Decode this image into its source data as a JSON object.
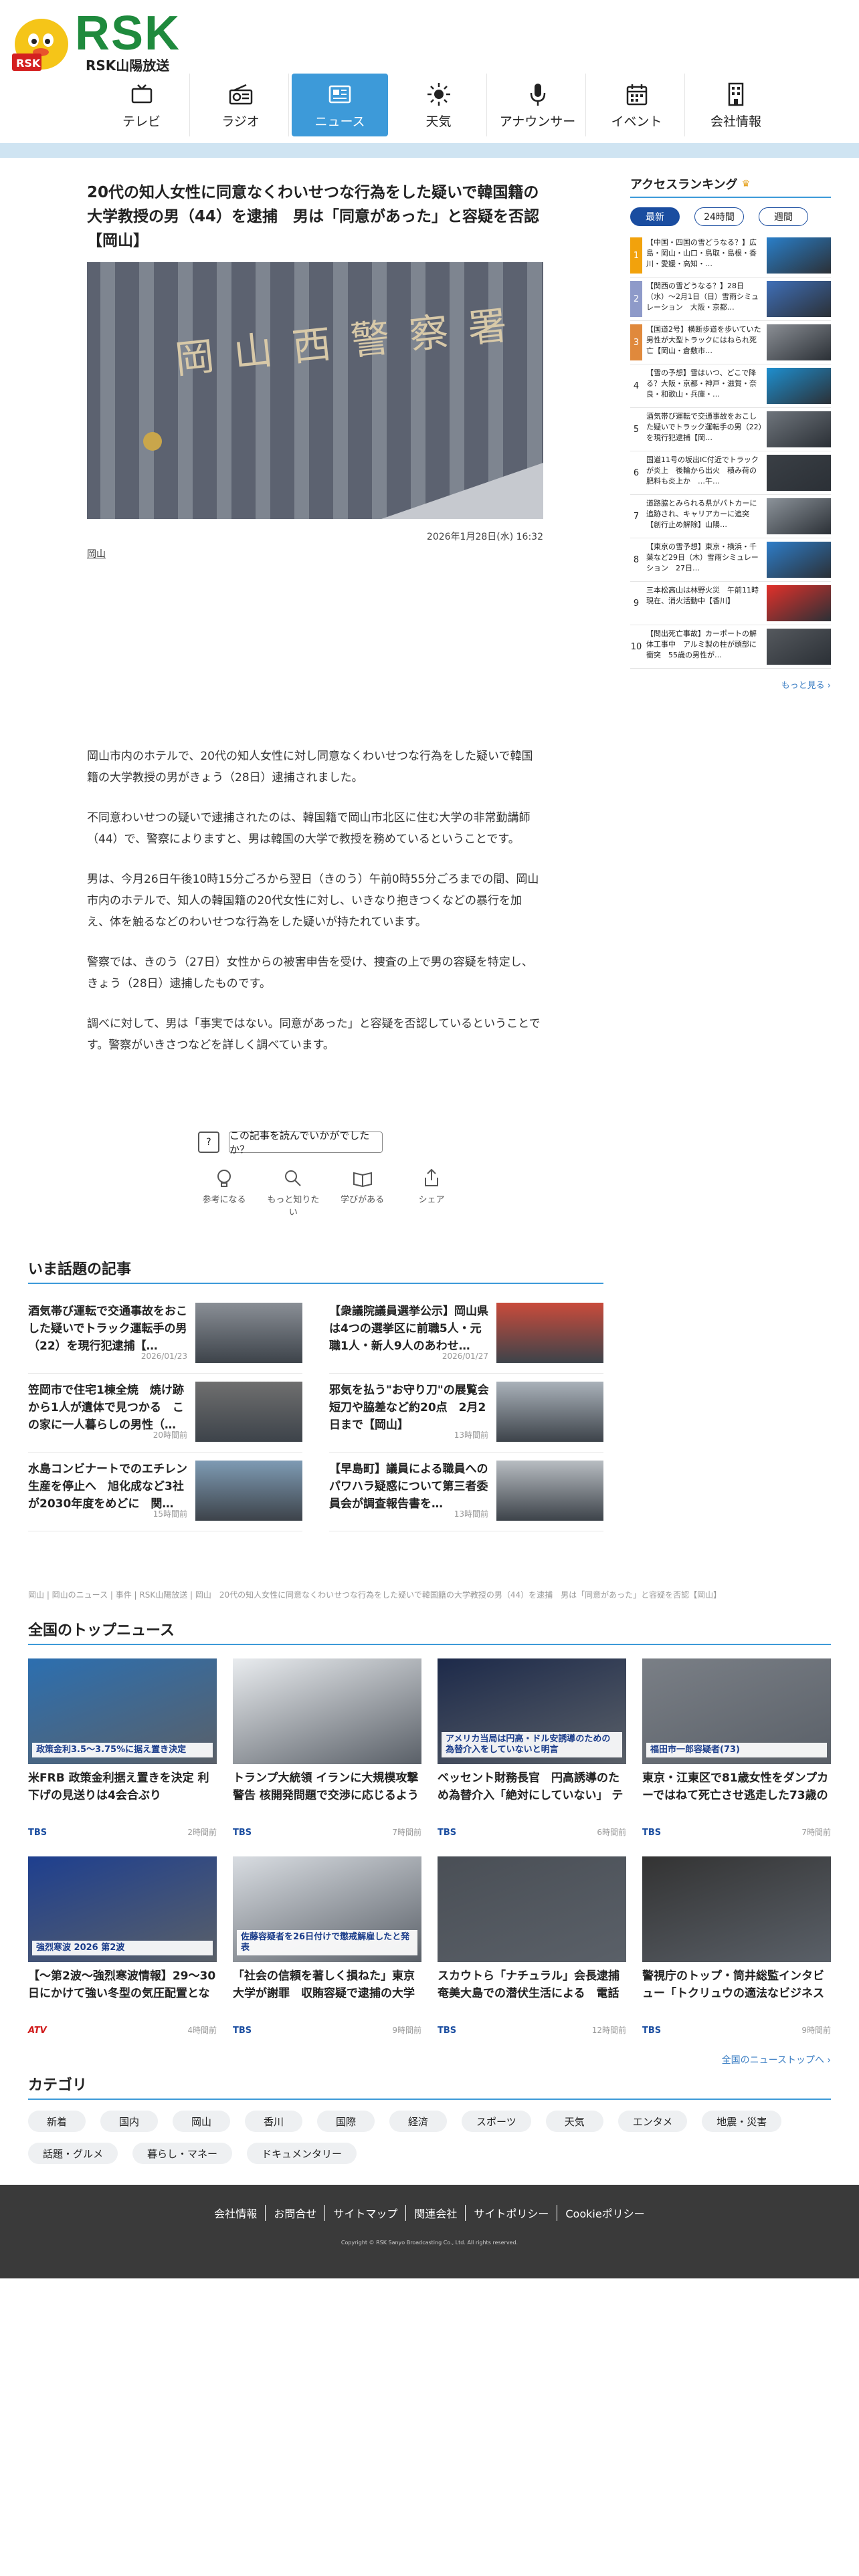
{
  "brand": {
    "logo": "RSK",
    "sub": "RSK山陽放送"
  },
  "nav": [
    {
      "label": "テレビ",
      "icon": "tv-icon"
    },
    {
      "label": "ラジオ",
      "icon": "radio-icon"
    },
    {
      "label": "ニュース",
      "icon": "news-icon",
      "active": true
    },
    {
      "label": "天気",
      "icon": "sun-icon"
    },
    {
      "label": "アナウンサー",
      "icon": "microphone-icon"
    },
    {
      "label": "イベント",
      "icon": "calendar-icon"
    },
    {
      "label": "会社情報",
      "icon": "building-icon"
    }
  ],
  "article": {
    "title": "20代の知人女性に同意なくわいせつな行為をした疑いで韓国籍の大学教授の男（44）を逮捕　男は「同意があった」と容疑を否認【岡山】",
    "photo_sign": "岡山西警察署",
    "date": "2026年1月28日(水) 16:32",
    "tag": "岡山",
    "body": [
      "岡山市内のホテルで、20代の知人女性に対し同意なくわいせつな行為をした疑いで韓国籍の大学教授の男がきょう（28日）逮捕されました。",
      "不同意わいせつの疑いで逮捕されたのは、韓国籍で岡山市北区に住む大学の非常勤講師（44）で、警察によりますと、男は韓国の大学で教授を務めているということです。",
      "男は、今月26日午後10時15分ごろから翌日（きのう）午前0時55分ごろまでの間、岡山市内のホテルで、知人の韓国籍の20代女性に対し、いきなり抱きつくなどの暴行を加え、体を触るなどのわいせつな行為をした疑いが持たれています。",
      "警察では、きのう（27日）女性からの被害申告を受け、捜査の上で男の容疑を特定し、きょう（28日）逮捕したものです。",
      "調べに対して、男は「事実ではない。同意があった」と容疑を否認しているということです。警察がいきさつなどを詳しく調べています。"
    ]
  },
  "feedback": {
    "icon_label": "?",
    "button": "この記事を読んでいかがでしたか？"
  },
  "reactions": [
    {
      "label": "参考になる",
      "icon": "lightbulb-icon"
    },
    {
      "label": "もっと知りたい",
      "icon": "magnifier-icon"
    },
    {
      "label": "学びがある",
      "icon": "book-icon"
    },
    {
      "label": "シェア",
      "icon": "share-icon"
    }
  ],
  "topics": {
    "title": "いま話題の記事",
    "items": [
      {
        "text": "酒気帯び運転で交通事故をおこした疑いでトラック運転手の男（22）を現行犯逮捕【…",
        "date": "2026/01/23"
      },
      {
        "text": "【衆議院議員選挙公示】岡山県は4つの選挙区に前職5人・元職1人・新人9人のあわせ…",
        "date": "2026/01/27"
      },
      {
        "text": "笠岡市で住宅1棟全焼　焼け跡から1人が遺体で見つかる　この家に一人暮らしの男性（…",
        "date": "20時間前"
      },
      {
        "text": "邪気を払う\"お守り刀\"の展覧会　短刀や脇差など約20点　2月2日まで【岡山】",
        "date": "13時間前"
      },
      {
        "text": "水島コンビナートでのエチレン生産を停止へ　旭化成など3社が2030年度をめどに　関…",
        "date": "15時間前"
      },
      {
        "text": "【早島町】議員による職員へのパワハラ疑惑について第三者委員会が調査報告書を…",
        "date": "13時間前"
      }
    ]
  },
  "breadcrumb": "岡山 | 岡山のニュース | 事件 | RSK山陽放送 | 岡山　20代の知人女性に同意なくわいせつな行為をした疑いで韓国籍の大学教授の男（44）を逮捕　男は「同意があった」と容疑を否認【岡山】",
  "national": {
    "title": "全国のトップニュース",
    "more": "全国のニューストップへ ›",
    "items": [
      {
        "text": "米FRB 政策金利据え置きを決定 利下げの見送りは4会合ぶり",
        "src": "TBS",
        "date": "2時間前",
        "overlay": "政策金利3.5～3.75%に据え置き決定"
      },
      {
        "text": "トランプ大統領 イランに大規模攻撃警告 核開発問題で交渉に応じるよう圧力 「対話準備も追い詰められれば激し…",
        "src": "TBS",
        "date": "7時間前",
        "overlay": ""
      },
      {
        "text": "ベッセント財務長官　円高誘導のため為替介入「絶対にしていない」 テレビ出演で明言",
        "src": "TBS",
        "date": "6時間前",
        "overlay": "アメリカ当局は円高・ドル安誘導のための為替介入をしていないと明言"
      },
      {
        "text": "東京・江東区で81歳女性をダンプカーではねて死亡させ逃走した73歳の男を逮捕　任意同行時には微量のアルコー…",
        "src": "TBS",
        "date": "7時間前",
        "overlay": "福田市一郎容疑者(73)"
      },
      {
        "text": "【〜第2波〜強烈寒波情報】29～30日にかけて強い冬型の気圧配置となる日本上空には強烈寒気　東北や東日本〜…",
        "src": "ATV",
        "date": "4時間前",
        "overlay": "強烈寒波 2026 第2波"
      },
      {
        "text": "「社会の信頼を著しく損ねた」東京大学が謝罪　収賄容疑で逮捕の大学院教授は懲戒解雇　総長は役員報酬の50…",
        "src": "TBS",
        "date": "9時間前",
        "overlay": "佐藤容疑者を26日付けで懲戒解雇したと発表"
      },
      {
        "text": "スカウトら「ナチュラル」会長逮捕 奄美大島での潜伏生活による　電話で指示するような様子に趣味のサーフィ…",
        "src": "TBS",
        "date": "12時間前",
        "overlay": ""
      },
      {
        "text": "警視庁のトップ・筒井総監インタビュー「トクリュウの適法なビジネスモデルの解体に力を入れる」「外国人と…",
        "src": "TBS",
        "date": "9時間前",
        "overlay": ""
      }
    ]
  },
  "categories": {
    "title": "カテゴリ",
    "items": [
      "新着",
      "国内",
      "岡山",
      "香川",
      "国際",
      "経済",
      "スポーツ",
      "天気",
      "エンタメ",
      "地震・災害",
      "話題・グルメ",
      "暮らし・マネー",
      "ドキュメンタリー"
    ]
  },
  "footer": {
    "links": [
      "会社情報",
      "お問合せ",
      "サイトマップ",
      "関連会社",
      "サイトポリシー",
      "Cookieポリシー"
    ],
    "copyright": "Copyright © RSK Sanyo Broadcasting Co., Ltd. All rights reserved."
  },
  "sidebar": {
    "title": "アクセスランキング",
    "tabs": [
      "最新",
      "24時間",
      "週間"
    ],
    "items": [
      "【中国・四国の雪どうなる？】広島・岡山・山口・鳥取・島根・香川・愛媛・高知・…",
      "【関西の雪どうなる？】28日（水）〜2月1日（日）雪雨シミュレーション　大阪・京都…",
      "【国道2号】横断歩道を歩いていた男性が大型トラックにはねられ死亡【岡山・倉敷市…",
      "【雪の予想】雪はいつ、どこで降る？大阪・京都・神戸・滋賀・奈良・和歌山・兵庫・…",
      "酒気帯び運転で交通事故をおこした疑いでトラック運転手の男（22）を現行犯逮捕【岡…",
      "国道11号の坂出IC付近でトラックが炎上　後輪から出火　積み荷の肥料も炎上か　…午…",
      "道路脇とみられる県がパトカーに追跡され、キャリアカーに追突【創行止め解除】山陽…",
      "【東京の雪予想】東京・横浜・千葉など29日（木）雪雨シミュレーション　27日…",
      "三本松高山は林野火災　午前11時現在、消火活動中【香川】",
      "【問出死亡事故】カーポートの解体工事中　アルミ製の柱が頭部に衝突　55歳の男性が…"
    ],
    "more": "もっと見る ›"
  }
}
